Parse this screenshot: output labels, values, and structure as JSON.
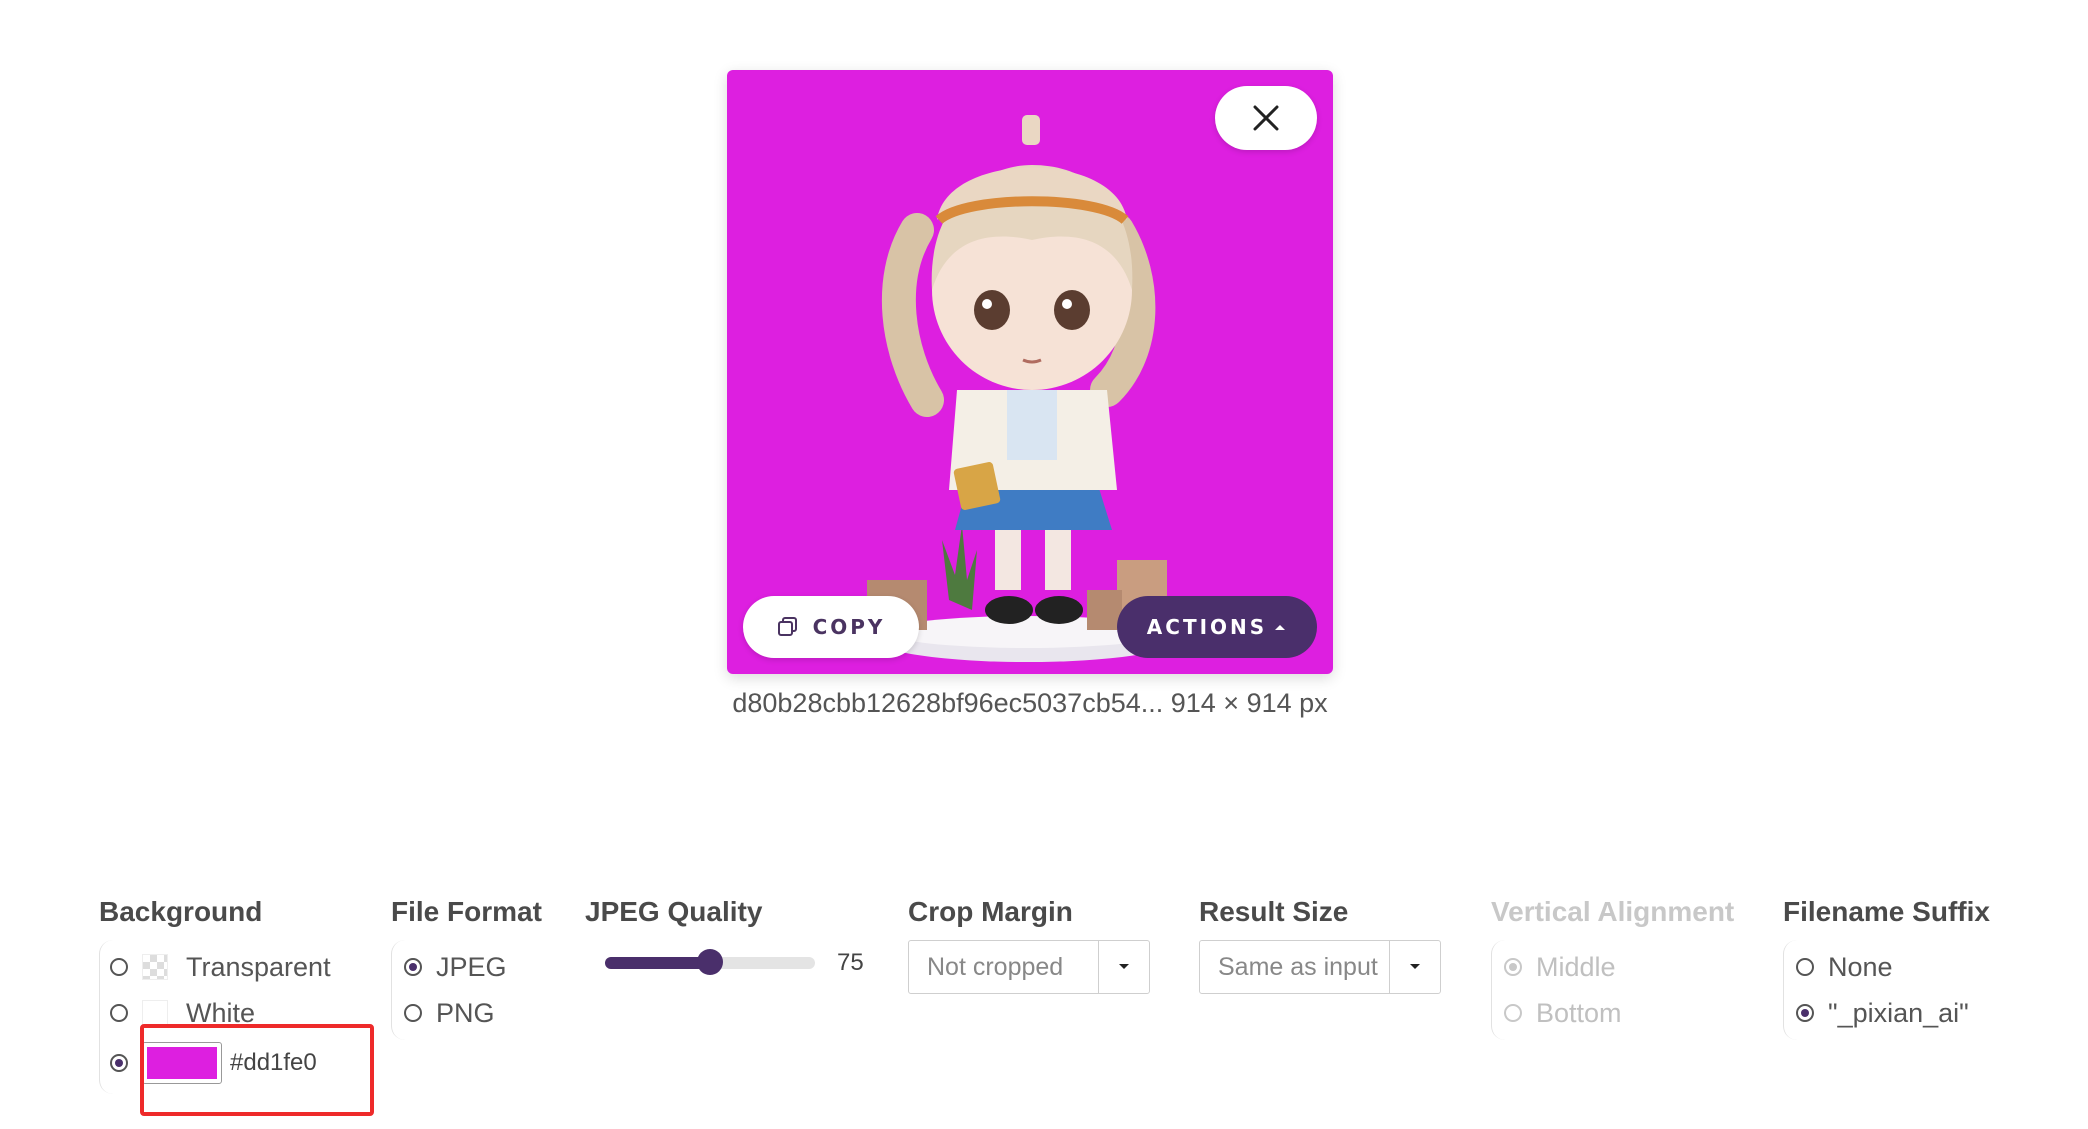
{
  "preview": {
    "copy_label": "COPY",
    "actions_label": "ACTIONS",
    "caption": "d80b28cbb12628bf96ec5037cb54... 914 × 914 px",
    "background_color": "#dd1fe0"
  },
  "settings": {
    "background": {
      "label": "Background",
      "options": [
        {
          "label": "Transparent",
          "selected": false
        },
        {
          "label": "White",
          "selected": false
        },
        {
          "label": "#dd1fe0",
          "selected": true
        }
      ],
      "custom_color": "#dd1fe0"
    },
    "file_format": {
      "label": "File Format",
      "options": [
        {
          "label": "JPEG",
          "selected": true
        },
        {
          "label": "PNG",
          "selected": false
        }
      ]
    },
    "jpeg_quality": {
      "label": "JPEG Quality",
      "value": "75",
      "fraction": 0.5
    },
    "crop_margin": {
      "label": "Crop Margin",
      "value": "Not cropped"
    },
    "result_size": {
      "label": "Result Size",
      "value": "Same as input"
    },
    "vertical_alignment": {
      "label": "Vertical Alignment",
      "disabled": true,
      "options": [
        {
          "label": "Middle",
          "selected": true
        },
        {
          "label": "Bottom",
          "selected": false
        }
      ]
    },
    "filename_suffix": {
      "label": "Filename Suffix",
      "options": [
        {
          "label": "None",
          "selected": false
        },
        {
          "label": "\"_pixian_ai\"",
          "selected": true
        }
      ]
    }
  },
  "icons": {
    "close": "close-icon",
    "copy": "copy-icon",
    "actions_caret": "caret-up-icon",
    "select_caret": "caret-down-icon"
  },
  "colors": {
    "accent": "#4a2f6b",
    "highlight": "#ee2a2a"
  }
}
